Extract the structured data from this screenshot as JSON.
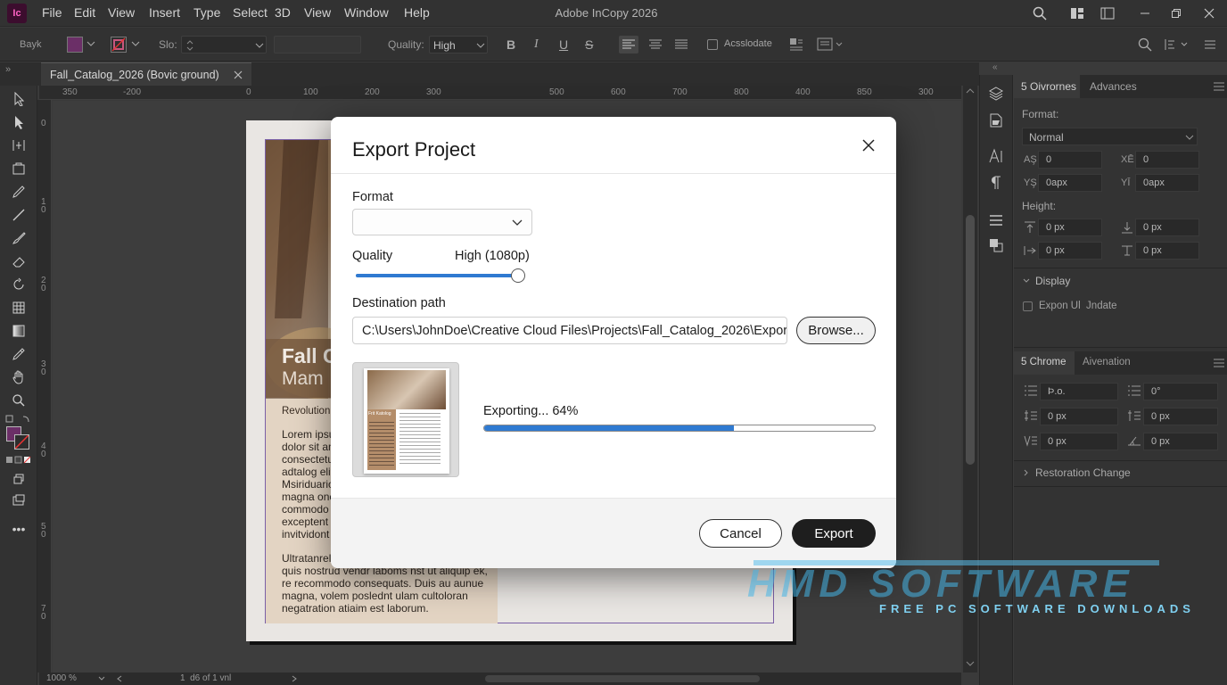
{
  "app": {
    "logo": "Ic",
    "title": "Adobe InCopy 2026"
  },
  "menu": [
    "File",
    "Edit",
    "View",
    "Insert",
    "Type",
    "Select",
    "3D",
    "View",
    "Window",
    "Help"
  ],
  "control_bar": {
    "preset": "Bayk",
    "size_label": "Slo:",
    "quality_label": "Quality:",
    "quality_value": "High",
    "checkbox_label": "Acsslodate",
    "fill_color": "#6b2f67"
  },
  "document": {
    "tab_title": "Fall_Catalog_2026 (Bovic ground)",
    "zoom": "1000 %",
    "page_status": "1  d6 of 1 vnl"
  },
  "ruler": {
    "h_ticks": [
      "350",
      "-200",
      "0",
      "100",
      "200",
      "300",
      "500",
      "600",
      "700",
      "800",
      "400",
      "850",
      "300"
    ],
    "v_ticks": [
      "0",
      "1\n0",
      "2\n0",
      "3\n0",
      "4\n0",
      "5\n0",
      "7\n0"
    ]
  },
  "page_content": {
    "title_line1": "Fall C",
    "title_line2": "Mam",
    "subheading": "Revolution",
    "para1": [
      "Lorem ipsu",
      "dolor sit am",
      "consectetup",
      "adtalog elit",
      "Msiriduarior",
      "magna one",
      "commodo d",
      "exceptent s",
      "invitvidont"
    ],
    "para2": [
      "Ultratanrel",
      "quis nostrud vendr laboms nst ut aliquip ek,",
      "re recommodo consequats. Duis au aunue",
      "magna, volem poslednt ulam cultoloran",
      "negatration atiaim est laborum."
    ]
  },
  "right_panel": {
    "tabs1": [
      "5 Oivrornes",
      "Advances"
    ],
    "format_label": "Format:",
    "format_value": "Normal",
    "fields_a": [
      {
        "label": "AŞ",
        "value": "0"
      },
      {
        "label": "XĒ",
        "value": "0"
      },
      {
        "label": "YŞ",
        "value": "0apx"
      },
      {
        "label": "YĪ",
        "value": "0apx"
      }
    ],
    "height_label": "Height:",
    "fields_b": [
      "0 px",
      "0 px",
      "0 px",
      "0 px"
    ],
    "display_label": "Display",
    "display_checkbox": "Expon Ul  Jndate",
    "tabs2": [
      "5 Chrome",
      "Aivenation"
    ],
    "fields_c": [
      "Ϸ.o.",
      "0°",
      "0 px",
      "0 px",
      "0 px",
      "0 px"
    ],
    "restoration_label": "Restoration Change"
  },
  "dialog": {
    "title": "Export Project",
    "format_label": "Format",
    "format_value": "",
    "quality_label": "Quality",
    "quality_value": "High (1080p)",
    "quality_level": 1.0,
    "destination_label": "Destination path",
    "destination_value": "C:\\Users\\JohnDoe\\Creative Cloud Files\\Projects\\Fall_Catalog_2026\\Exports\\",
    "browse_label": "Browse...",
    "progress_label": "Exporting... 64%",
    "progress": 0.64,
    "thumb_title": "Frit Katolog",
    "cancel_label": "Cancel",
    "export_label": "Export",
    "accent": "#2f7ad1"
  },
  "watermark": {
    "line1": "HMD SOFTWARE",
    "line2": "FREE PC SOFTWARE DOWNLOADS"
  }
}
